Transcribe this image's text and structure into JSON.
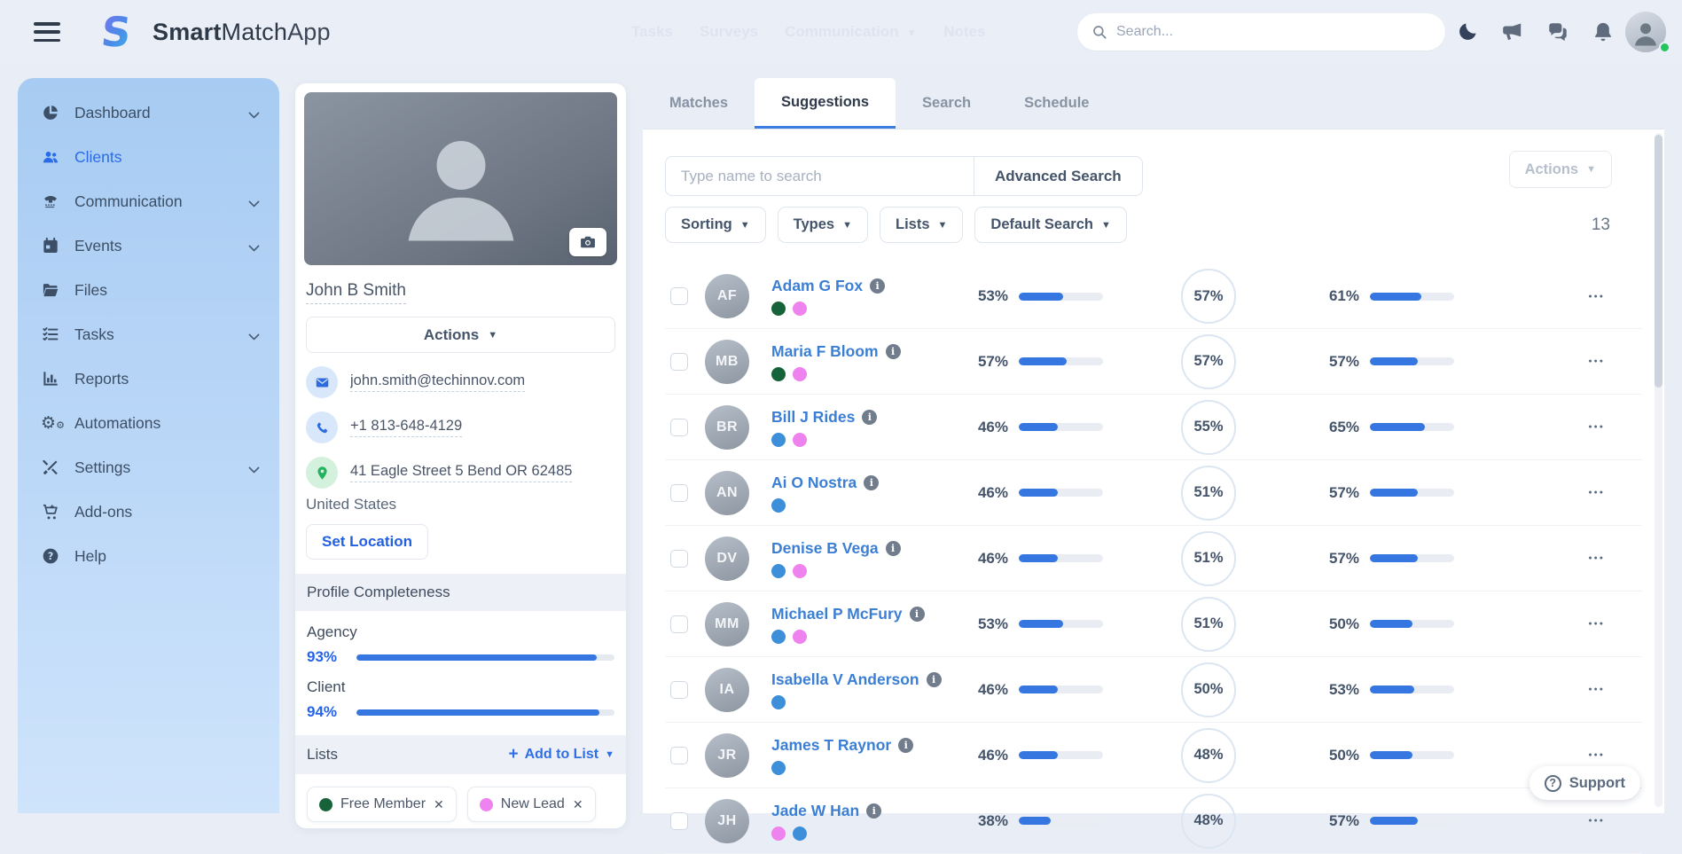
{
  "header": {
    "brand": {
      "part1": "Smart",
      "part2": "Match",
      "part3": "App"
    },
    "ghost_nav": {
      "items": [
        "Tasks",
        "Surveys",
        "Communication",
        "Notes"
      ],
      "dropdown_index": 2
    },
    "search": {
      "placeholder": "Search..."
    }
  },
  "sidebar": {
    "items": [
      {
        "label": "Dashboard",
        "icon": "pie-chart-icon",
        "chevron": true,
        "active": false
      },
      {
        "label": "Clients",
        "icon": "users-icon",
        "chevron": false,
        "active": true
      },
      {
        "label": "Communication",
        "icon": "phone-icon",
        "chevron": true,
        "active": false
      },
      {
        "label": "Events",
        "icon": "calendar-icon",
        "chevron": true,
        "active": false
      },
      {
        "label": "Files",
        "icon": "folder-icon",
        "chevron": false,
        "active": false
      },
      {
        "label": "Tasks",
        "icon": "task-list-icon",
        "chevron": true,
        "active": false
      },
      {
        "label": "Reports",
        "icon": "bar-chart-icon",
        "chevron": false,
        "active": false
      },
      {
        "label": "Automations",
        "icon": "gears-icon",
        "chevron": false,
        "active": false
      },
      {
        "label": "Settings",
        "icon": "tools-icon",
        "chevron": true,
        "active": false
      },
      {
        "label": "Add-ons",
        "icon": "cart-icon",
        "chevron": false,
        "active": false
      },
      {
        "label": "Help",
        "icon": "help-icon",
        "chevron": false,
        "active": false
      }
    ]
  },
  "profile": {
    "name": "John B Smith",
    "actions_label": "Actions",
    "email": "john.smith@techinnov.com",
    "phone": "+1 813-648-4129",
    "address": "41 Eagle Street 5 Bend OR 62485",
    "country": "United States",
    "set_location_label": "Set Location",
    "completeness": {
      "title": "Profile Completeness",
      "items": [
        {
          "label": "Agency",
          "percent": 93
        },
        {
          "label": "Client",
          "percent": 94
        }
      ]
    },
    "lists": {
      "title": "Lists",
      "add_label": "Add to List",
      "tags": [
        {
          "label": "Free Member",
          "color": "#176339"
        },
        {
          "label": "New Lead",
          "color": "#ee82ee"
        }
      ]
    }
  },
  "main": {
    "tabs": [
      {
        "label": "Matches",
        "active": false
      },
      {
        "label": "Suggestions",
        "active": true
      },
      {
        "label": "Search",
        "active": false
      },
      {
        "label": "Schedule",
        "active": false
      }
    ],
    "search_placeholder": "Type name to search",
    "advanced_search_label": "Advanced Search",
    "actions_label": "Actions",
    "filters": [
      {
        "label": "Sorting"
      },
      {
        "label": "Types"
      },
      {
        "label": "Lists"
      },
      {
        "label": "Default Search"
      }
    ],
    "result_count": "13",
    "rows": [
      {
        "name": "Adam G Fox",
        "dots": [
          "green",
          "pink"
        ],
        "pct1": 53,
        "pct2": 57,
        "pct3": 61
      },
      {
        "name": "Maria F Bloom",
        "dots": [
          "green",
          "pink"
        ],
        "pct1": 57,
        "pct2": 57,
        "pct3": 57
      },
      {
        "name": "Bill J Rides",
        "dots": [
          "blue",
          "pink"
        ],
        "pct1": 46,
        "pct2": 55,
        "pct3": 65
      },
      {
        "name": "Ai O Nostra",
        "dots": [
          "blue"
        ],
        "pct1": 46,
        "pct2": 51,
        "pct3": 57
      },
      {
        "name": "Denise B Vega",
        "dots": [
          "blue",
          "pink"
        ],
        "pct1": 46,
        "pct2": 51,
        "pct3": 57
      },
      {
        "name": "Michael P McFury",
        "dots": [
          "blue",
          "pink"
        ],
        "pct1": 53,
        "pct2": 51,
        "pct3": 50
      },
      {
        "name": "Isabella V Anderson",
        "dots": [
          "blue"
        ],
        "pct1": 46,
        "pct2": 50,
        "pct3": 53
      },
      {
        "name": "James T Raynor",
        "dots": [
          "blue"
        ],
        "pct1": 46,
        "pct2": 48,
        "pct3": 50
      },
      {
        "name": "Jade W Han",
        "dots": [
          "pink",
          "blue"
        ],
        "pct1": 38,
        "pct2": 48,
        "pct3": 57
      }
    ],
    "support_label": "Support"
  },
  "colors": {
    "accent_blue": "#3576e0",
    "link_blue": "#3b7fd4",
    "dot_green": "#176339",
    "dot_pink": "#ee82ee",
    "dot_blue": "#3d8fd9",
    "online_green": "#22c55e"
  }
}
